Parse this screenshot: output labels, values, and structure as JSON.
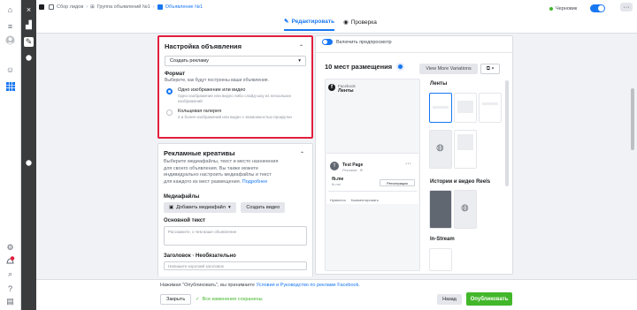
{
  "breadcrumb": {
    "campaign": "Сбор лидов",
    "adset": "Группа объявлений №1",
    "ad": "Объявление №1"
  },
  "tabs": [
    {
      "label": "Редактировать",
      "active": true,
      "icon": "pencil-icon"
    },
    {
      "label": "Проверка",
      "active": false,
      "icon": "eye-icon"
    }
  ],
  "status": {
    "label": "Черновик",
    "toggle_on": true,
    "more_label": "···"
  },
  "ad_setup": {
    "title": "Настройка объявления",
    "dropdown_value": "Создать рекламу",
    "format_label": "Формат",
    "format_help": "Выберите, как будут построены ваши объявления.",
    "options": [
      {
        "title": "Одно изображение или видео",
        "desc": "Одно изображение или видео либо слайд-шоу из нескольких изображений",
        "selected": true
      },
      {
        "title": "Кольцевая галерея",
        "desc": "2 и более изображений или видео с возможностью прокрутки",
        "selected": false
      }
    ]
  },
  "creatives": {
    "title": "Рекламные креативы",
    "desc": "Выберите медиафайлы, текст и место назначения для своего объявления. Вы также можете индивидуально настроить медиафайлы и текст для каждого из мест размещения.",
    "more_link": "Подробнее",
    "media_label": "Медиафайлы",
    "add_media": "Добавить медиафайл",
    "create_video": "Создать видео",
    "primary_text_label": "Основной текст",
    "primary_text_placeholder": "Расскажите, о чем ваше объявление",
    "headline_label": "Заголовок · Необязательно",
    "headline_placeholder": "Напишите короткий заголовок"
  },
  "preview": {
    "toggle_label": "Включить предпросмотр",
    "placements_title": "10 мест размещения",
    "view_more": "View More Variations",
    "fb_label": "Facebook",
    "feed_label": "Ленты",
    "page_name": "Test Page",
    "sponsored": "Реклама · ⊕",
    "link_domain": "fb.me",
    "link_sub": "fb.me",
    "cta": "Регистрация",
    "actions": [
      "Нравится",
      "Комментировать"
    ],
    "gallery_sections": [
      "Ленты",
      "Истории и видео Reels",
      "In-Stream"
    ]
  },
  "footer": {
    "legal_prefix": "Нажимая \"Опубликовать\", вы принимаете ",
    "legal_link": "Условия и Руководство по рекламе Facebook",
    "close": "Закрыть",
    "saved": "Все изменения сохранены",
    "back": "Назад",
    "publish": "Опубликовать"
  }
}
